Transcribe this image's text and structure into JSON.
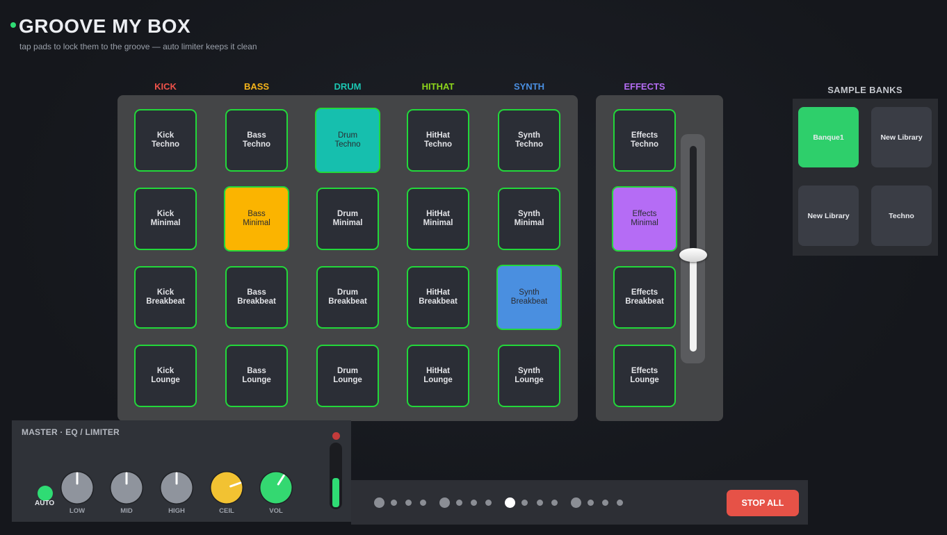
{
  "header": {
    "title": "GROOVE MY BOX",
    "subtitle": "tap pads to lock them to the groove — auto limiter keeps it clean"
  },
  "columns": [
    {
      "label": "KICK",
      "color": "#f0524a"
    },
    {
      "label": "BASS",
      "color": "#f5b41a"
    },
    {
      "label": "DRUM",
      "color": "#1bc6b2"
    },
    {
      "label": "HITHAT",
      "color": "#8ed61b"
    },
    {
      "label": "SYNTH",
      "color": "#4a8ee0"
    },
    {
      "label": "EFFECTS",
      "color": "#b46cf2"
    }
  ],
  "pads": [
    [
      {
        "label": "Kick\nTechno",
        "active": false
      },
      {
        "label": "Bass\nTechno",
        "active": false
      },
      {
        "label": "Drum\nTechno",
        "active": true,
        "color": "#16bfae"
      },
      {
        "label": "HitHat\nTechno",
        "active": false
      },
      {
        "label": "Synth\nTechno",
        "active": false
      },
      {
        "label": "Effects\nTechno",
        "active": false
      }
    ],
    [
      {
        "label": "Kick\nMinimal",
        "active": false
      },
      {
        "label": "Bass\nMinimal",
        "active": true,
        "color": "#fbb400"
      },
      {
        "label": "Drum\nMinimal",
        "active": false
      },
      {
        "label": "HitHat\nMinimal",
        "active": false
      },
      {
        "label": "Synth\nMinimal",
        "active": false
      },
      {
        "label": "Effects\nMinimal",
        "active": true,
        "color": "#b56cf5"
      }
    ],
    [
      {
        "label": "Kick\nBreakbeat",
        "active": false
      },
      {
        "label": "Bass\nBreakbeat",
        "active": false
      },
      {
        "label": "Drum\nBreakbeat",
        "active": false
      },
      {
        "label": "HitHat\nBreakbeat",
        "active": false
      },
      {
        "label": "Synth\nBreakbeat",
        "active": true,
        "color": "#4a8fe0"
      },
      {
        "label": "Effects\nBreakbeat",
        "active": false
      }
    ],
    [
      {
        "label": "Kick\nLounge",
        "active": false
      },
      {
        "label": "Bass\nLounge",
        "active": false
      },
      {
        "label": "Drum\nLounge",
        "active": false
      },
      {
        "label": "HitHat\nLounge",
        "active": false
      },
      {
        "label": "Synth\nLounge",
        "active": false
      },
      {
        "label": "Effects\nLounge",
        "active": false
      }
    ]
  ],
  "effects_fader": {
    "level": 0.47
  },
  "sample_banks": {
    "title": "SAMPLE BANKS",
    "items": [
      {
        "label": "Banque1",
        "selected": true
      },
      {
        "label": "New Library",
        "selected": false
      },
      {
        "label": "New Library",
        "selected": false
      },
      {
        "label": "Techno",
        "selected": false
      }
    ]
  },
  "master": {
    "title": "MASTER  ·  EQ / LIMITER",
    "auto_label": "AUTO",
    "knobs": [
      {
        "label": "LOW",
        "value": 0.5,
        "color": "#8f949d"
      },
      {
        "label": "MID",
        "value": 0.5,
        "color": "#8f949d"
      },
      {
        "label": "HIGH",
        "value": 0.5,
        "color": "#8f949d"
      },
      {
        "label": "CEIL",
        "value": 0.76,
        "color": "#f2c232"
      },
      {
        "label": "VOL",
        "value": 0.62,
        "color": "#34d871"
      }
    ],
    "meter_level": 0.47
  },
  "sequencer": {
    "steps": 16,
    "current_step": 8,
    "stop_label": "STOP ALL"
  }
}
